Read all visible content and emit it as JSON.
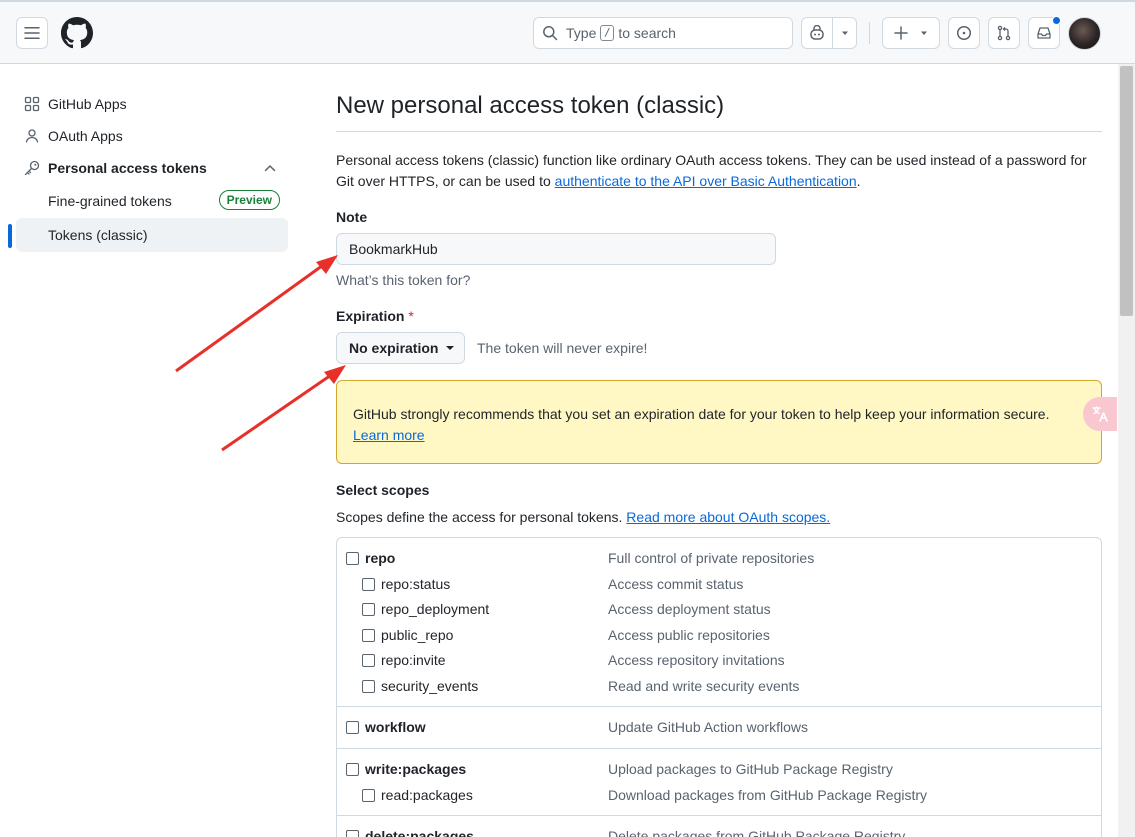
{
  "header": {
    "search_prefix": "Type",
    "search_key": "/",
    "search_suffix": "to search"
  },
  "sidebar": {
    "items": [
      {
        "label": "GitHub Apps",
        "icon": "apps-icon"
      },
      {
        "label": "OAuth Apps",
        "icon": "person-icon"
      },
      {
        "label": "Personal access tokens",
        "icon": "key-icon"
      }
    ],
    "sub_items": [
      {
        "label": "Fine-grained tokens",
        "badge": "Preview"
      },
      {
        "label": "Tokens (classic)",
        "active": true
      }
    ]
  },
  "main": {
    "title": "New personal access token (classic)",
    "description_prefix": "Personal access tokens (classic) function like ordinary OAuth access tokens. They can be used instead of a password for Git over HTTPS, or can be used to ",
    "description_link": "authenticate to the API over Basic Authentication",
    "description_suffix": ".",
    "note_label": "Note",
    "note_value": "BookmarkHub",
    "note_hint": "What’s this token for?",
    "expiration_label": "Expiration",
    "expiration_required": "*",
    "expiration_value": "No expiration",
    "expiration_note": "The token will never expire!",
    "warning_text": "GitHub strongly recommends that you set an expiration date for your token to help keep your information secure.",
    "warning_link": "Learn more",
    "scopes_heading": "Select scopes",
    "scopes_desc": "Scopes define the access for personal tokens.",
    "scopes_link": "Read more about OAuth scopes.",
    "scope_groups": [
      {
        "name": "repo",
        "desc": "Full control of private repositories",
        "children": [
          {
            "name": "repo:status",
            "desc": "Access commit status"
          },
          {
            "name": "repo_deployment",
            "desc": "Access deployment status"
          },
          {
            "name": "public_repo",
            "desc": "Access public repositories"
          },
          {
            "name": "repo:invite",
            "desc": "Access repository invitations"
          },
          {
            "name": "security_events",
            "desc": "Read and write security events"
          }
        ]
      },
      {
        "name": "workflow",
        "desc": "Update GitHub Action workflows",
        "children": []
      },
      {
        "name": "write:packages",
        "desc": "Upload packages to GitHub Package Registry",
        "children": [
          {
            "name": "read:packages",
            "desc": "Download packages from GitHub Package Registry"
          }
        ]
      },
      {
        "name": "delete:packages",
        "desc": "Delete packages from GitHub Package Registry",
        "children": []
      }
    ]
  },
  "translate_icon": "translate-icon",
  "colors": {
    "accent": "#0969da",
    "warning_bg": "#fff8c5",
    "annotation": "#e8302a"
  }
}
